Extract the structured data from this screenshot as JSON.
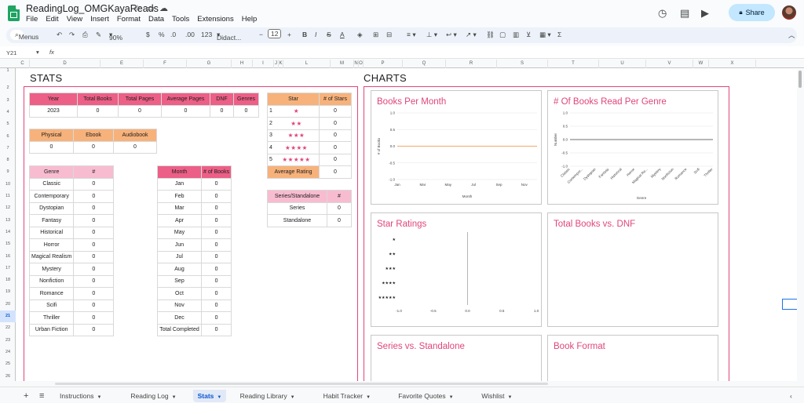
{
  "app": {
    "doc_title": "ReadingLog_OMGKayaReads",
    "menu": [
      "File",
      "Edit",
      "View",
      "Insert",
      "Format",
      "Data",
      "Tools",
      "Extensions",
      "Help"
    ],
    "share_label": "Share"
  },
  "toolbar": {
    "search_label": "Menus",
    "zoom": "90%",
    "currency": "$",
    "percent": "%",
    "decimal_dec": ".0",
    "decimal_inc": ".00",
    "number_format": "123",
    "font": "Didact...",
    "font_size": "12"
  },
  "formula": {
    "cell_ref": "Y21",
    "fx": "fx"
  },
  "columns": [
    "C",
    "D",
    "E",
    "F",
    "G",
    "H",
    "I",
    "J",
    "K",
    "L",
    "M",
    "N",
    "O",
    "P",
    "Q",
    "R",
    "S",
    "T",
    "U",
    "V",
    "W",
    "X"
  ],
  "rows": [
    "1",
    "2",
    "3",
    "4",
    "5",
    "6",
    "7",
    "8",
    "9",
    "10",
    "11",
    "12",
    "13",
    "14",
    "15",
    "16",
    "17",
    "18",
    "19",
    "20",
    "21",
    "22",
    "23",
    "24",
    "25",
    "26",
    "27"
  ],
  "active_row": "21",
  "stats": {
    "title": "STATS",
    "summary_headers": [
      "Year",
      "Total Books",
      "Total Pages",
      "Average Pages",
      "DNF",
      "Genres"
    ],
    "summary_values": [
      "2023",
      "0",
      "0",
      "0",
      "0",
      "0"
    ],
    "format_headers": [
      "Physical",
      "Ebook",
      "Audiobook"
    ],
    "format_values": [
      "0",
      "0",
      "0"
    ],
    "genre_header": "Genre",
    "genre_count_header": "#",
    "genres": [
      {
        "name": "Classic",
        "count": "0"
      },
      {
        "name": "Contemporary",
        "count": "0"
      },
      {
        "name": "Dystopian",
        "count": "0"
      },
      {
        "name": "Fantasy",
        "count": "0"
      },
      {
        "name": "Historical",
        "count": "0"
      },
      {
        "name": "Horror",
        "count": "0"
      },
      {
        "name": "Magical Realism",
        "count": "0"
      },
      {
        "name": "Mystery",
        "count": "0"
      },
      {
        "name": "Nonfiction",
        "count": "0"
      },
      {
        "name": "Romance",
        "count": "0"
      },
      {
        "name": "Scifi",
        "count": "0"
      },
      {
        "name": "Thriller",
        "count": "0"
      },
      {
        "name": "Urban Fiction",
        "count": "0"
      }
    ],
    "month_header": "Month",
    "month_count_header": "# of Books",
    "months": [
      {
        "name": "Jan",
        "count": "0"
      },
      {
        "name": "Feb",
        "count": "0"
      },
      {
        "name": "Mar",
        "count": "0"
      },
      {
        "name": "Apr",
        "count": "0"
      },
      {
        "name": "May",
        "count": "0"
      },
      {
        "name": "Jun",
        "count": "0"
      },
      {
        "name": "Jul",
        "count": "0"
      },
      {
        "name": "Aug",
        "count": "0"
      },
      {
        "name": "Sep",
        "count": "0"
      },
      {
        "name": "Oct",
        "count": "0"
      },
      {
        "name": "Nov",
        "count": "0"
      },
      {
        "name": "Dec",
        "count": "0"
      },
      {
        "name": "Total Completed",
        "count": "0"
      }
    ],
    "star_header": "Star",
    "star_count_header": "# of Stars",
    "stars": [
      {
        "n": "1",
        "stars": "★",
        "count": "0"
      },
      {
        "n": "2",
        "stars": "★★",
        "count": "0"
      },
      {
        "n": "3",
        "stars": "★★★",
        "count": "0"
      },
      {
        "n": "4",
        "stars": "★★★★",
        "count": "0"
      },
      {
        "n": "5",
        "stars": "★★★★★",
        "count": "0"
      }
    ],
    "avg_rating_label": "Average Rating",
    "avg_rating_value": "0",
    "series_header": "Series/Standalone",
    "series_count_header": "#",
    "series_rows": [
      {
        "name": "Series",
        "count": "0"
      },
      {
        "name": "Standalone",
        "count": "0"
      }
    ]
  },
  "charts_section": {
    "title": "CHARTS",
    "accent_color": "#e0457b",
    "charts": [
      {
        "title": "Books Per Month"
      },
      {
        "title": "# Of Books Read Per Genre"
      },
      {
        "title": "Star Ratings"
      },
      {
        "title": "Total Books vs. DNF"
      },
      {
        "title": "Series vs. Standalone"
      },
      {
        "title": "Book Format"
      }
    ]
  },
  "chart_data": [
    {
      "type": "line",
      "title": "Books Per Month",
      "xlabel": "Month",
      "ylabel": "# of Books",
      "categories": [
        "Jan",
        "Feb",
        "Mar",
        "Apr",
        "May",
        "Jun",
        "Jul",
        "Aug",
        "Sep",
        "Oct",
        "Nov",
        "Dec"
      ],
      "x_tick_labels": [
        "Jan",
        "Mar",
        "May",
        "Jul",
        "Sep",
        "Nov"
      ],
      "values": [
        0,
        0,
        0,
        0,
        0,
        0,
        0,
        0,
        0,
        0,
        0,
        0
      ],
      "ylim": [
        -1.0,
        1.0
      ],
      "y_ticks": [
        "1.0",
        "0.5",
        "0.0",
        "-0.5",
        "-1.0"
      ],
      "series_color": "#f7b27b"
    },
    {
      "type": "line",
      "title": "# Of Books Read Per Genre",
      "xlabel": "Genre",
      "ylabel": "Number",
      "categories": [
        "Classic",
        "Contempor...",
        "Dystopian",
        "Fantasy",
        "Historical",
        "Horror",
        "Magical Re...",
        "Mystery",
        "Nonfiction",
        "Romance",
        "Scifi",
        "Thriller"
      ],
      "values": [
        0,
        0,
        0,
        0,
        0,
        0,
        0,
        0,
        0,
        0,
        0,
        0
      ],
      "ylim": [
        -1.0,
        1.0
      ],
      "y_ticks": [
        "1.0",
        "0.5",
        "0.0",
        "-0.5",
        "-1.0"
      ],
      "series_color": "#8c8c8c"
    },
    {
      "type": "bar",
      "title": "Star Ratings",
      "categories": [
        "★",
        "★★",
        "★★★",
        "★★★★",
        "★★★★★"
      ],
      "values": [
        0,
        0,
        0,
        0,
        0
      ],
      "xlim": [
        -1.0,
        1.0
      ],
      "x_ticks": [
        "-1.0",
        "-0.5",
        "0.0",
        "0.5",
        "1.0"
      ]
    }
  ],
  "sheet_tabs": {
    "add_icon": "+",
    "list_icon": "≡",
    "tabs": [
      {
        "label": "Instructions",
        "active": false
      },
      {
        "label": "Reading Log",
        "active": false
      },
      {
        "label": "Stats",
        "active": true
      },
      {
        "label": "Reading Library",
        "active": false
      },
      {
        "label": "Habit Tracker",
        "active": false
      },
      {
        "label": "Favorite Quotes",
        "active": false
      },
      {
        "label": "Wishlist",
        "active": false
      }
    ]
  }
}
